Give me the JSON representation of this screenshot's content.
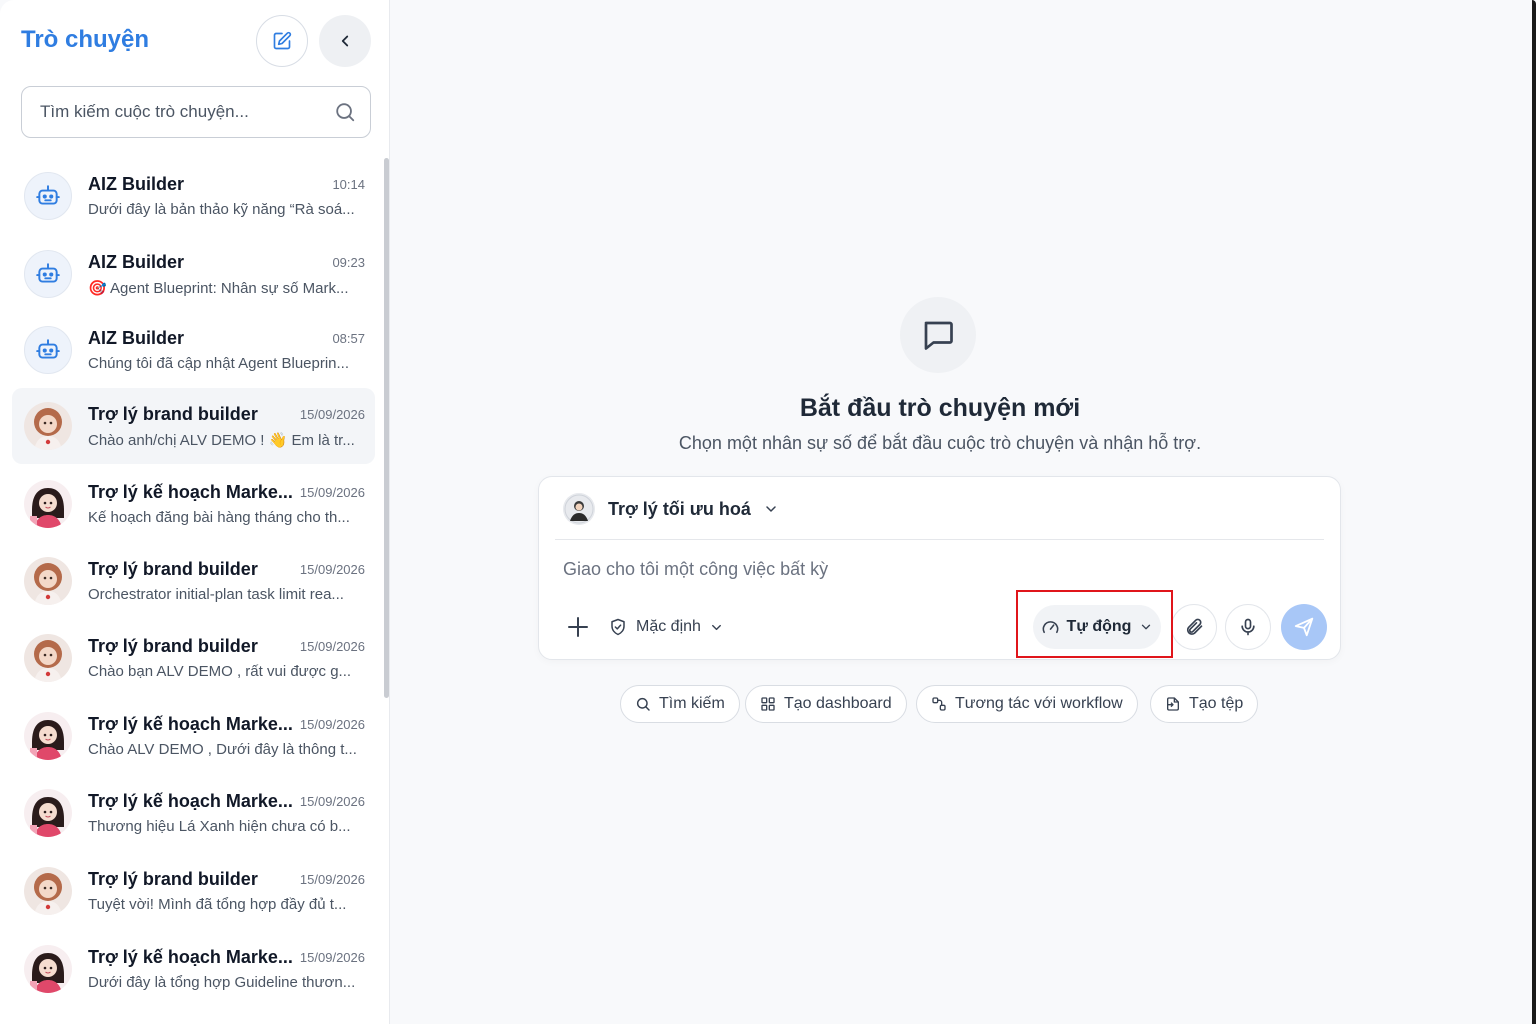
{
  "sidebar": {
    "title": "Trò chuyện",
    "search_placeholder": "Tìm kiếm cuộc trò chuyện...",
    "conversations": [
      {
        "name": "AIZ Builder",
        "time": "10:14",
        "preview": "Dưới đây là bản thảo kỹ năng “Rà soá...",
        "avatar": "bot-icon"
      },
      {
        "name": "AIZ Builder",
        "time": "09:23",
        "preview": "🎯 Agent Blueprint: Nhân sự số Mark...",
        "avatar": "bot-icon"
      },
      {
        "name": "AIZ Builder",
        "time": "08:57",
        "preview": "Chúng tôi đã cập nhật Agent Blueprin...",
        "avatar": "bot-icon"
      },
      {
        "name": "Trợ lý brand builder",
        "time": "15/09/2026",
        "preview": "Chào anh/chị ALV DEMO ! 👋 Em là tr...",
        "avatar": "doll-avatar"
      },
      {
        "name": "Trợ lý kế hoạch Marke...",
        "time": "15/09/2026",
        "preview": "Kế hoạch đăng bài hàng tháng cho th...",
        "avatar": "girl-avatar"
      },
      {
        "name": "Trợ lý brand builder",
        "time": "15/09/2026",
        "preview": "Orchestrator initial-plan task limit rea...",
        "avatar": "doll-avatar"
      },
      {
        "name": "Trợ lý brand builder",
        "time": "15/09/2026",
        "preview": "Chào bạn ALV DEMO , rất vui được g...",
        "avatar": "doll-avatar"
      },
      {
        "name": "Trợ lý kế hoạch Marke...",
        "time": "15/09/2026",
        "preview": "Chào ALV DEMO , Dưới đây là thông t...",
        "avatar": "girl-avatar"
      },
      {
        "name": "Trợ lý kế hoạch Marke...",
        "time": "15/09/2026",
        "preview": "Thương hiệu Lá Xanh hiện chưa có b...",
        "avatar": "girl-avatar"
      },
      {
        "name": "Trợ lý brand builder",
        "time": "15/09/2026",
        "preview": "Tuyệt vời! Mình đã tổng hợp đầy đủ t...",
        "avatar": "doll-avatar"
      },
      {
        "name": "Trợ lý kế hoạch Marke...",
        "time": "15/09/2026",
        "preview": "Dưới đây là tổng hợp Guideline thươn...",
        "avatar": "girl-avatar"
      }
    ]
  },
  "main": {
    "title": "Bắt đầu trò chuyện mới",
    "subtitle": "Chọn một nhân sự số để bắt đầu cuộc trò chuyện và nhận hỗ trợ.",
    "composer": {
      "agent_name": "Trợ lý tối ưu hoá",
      "input_placeholder": "Giao cho tôi một công việc bất kỳ",
      "mode_label": "Mặc định",
      "auto_label": "Tự động"
    },
    "chips": [
      "Tìm kiếm",
      "Tạo dashboard",
      "Tương tác với workflow",
      "Tạo tệp"
    ]
  },
  "colors": {
    "accent": "#2f7de1",
    "send_button": "#a8c7f7",
    "highlight": "#e0151b"
  }
}
